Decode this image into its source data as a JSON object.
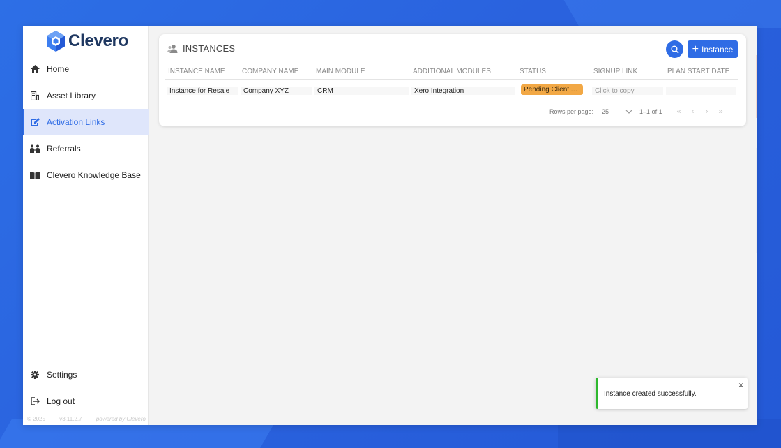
{
  "brand": {
    "name": "Clevero",
    "logo_icon": "clevero-cube-logo",
    "accent": "#2f6ce5"
  },
  "sidebar": {
    "items": [
      {
        "label": "Home",
        "icon": "home-icon",
        "active": false
      },
      {
        "label": "Asset Library",
        "icon": "library-icon",
        "active": false
      },
      {
        "label": "Activation Links",
        "icon": "edit-link-icon",
        "active": true
      },
      {
        "label": "Referrals",
        "icon": "people-icon",
        "active": false
      },
      {
        "label": "Clevero Knowledge Base",
        "icon": "book-icon",
        "active": false
      }
    ],
    "bottom_items": [
      {
        "label": "Settings",
        "icon": "gear-icon"
      },
      {
        "label": "Log out",
        "icon": "logout-icon"
      }
    ],
    "footer": {
      "copyright": "© 2025",
      "version": "v3.11.2.7",
      "powered": "powered by Clevero"
    }
  },
  "instances": {
    "title": "INSTANCES",
    "add_button_label": "Instance",
    "columns": [
      "INSTANCE NAME",
      "COMPANY NAME",
      "MAIN MODULE",
      "ADDITIONAL MODULES",
      "STATUS",
      "SIGNUP LINK",
      "PLAN START DATE"
    ],
    "rows": [
      {
        "instance_name": "Instance for Resale",
        "company_name": "Company XYZ",
        "main_module": "CRM",
        "additional_modules": "Xero Integration",
        "status": "Pending Client A...",
        "status_color": "#f2a845",
        "signup_link": "Click to copy",
        "plan_start_date": ""
      }
    ],
    "pagination": {
      "rows_per_page_label": "Rows per page:",
      "rows_per_page": "25",
      "range": "1–1 of 1"
    }
  },
  "toast": {
    "message": "Instance created successfully.",
    "close_symbol": "×",
    "status_color": "#2eb82e"
  }
}
